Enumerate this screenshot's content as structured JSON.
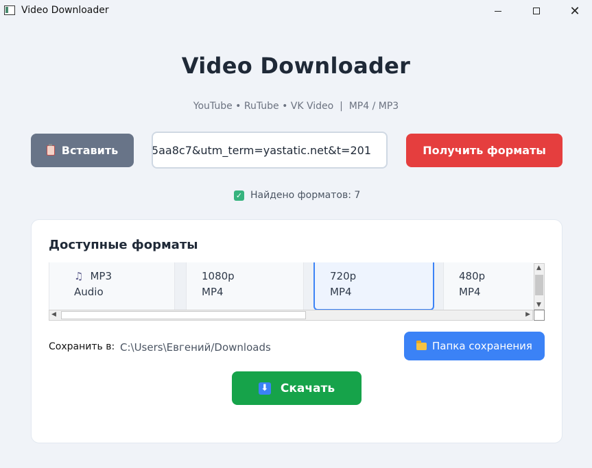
{
  "window": {
    "title": "Video Downloader",
    "min_glyph": "",
    "close_glyph": "✕"
  },
  "header": {
    "title": "Video Downloader",
    "subtitle": "YouTube • RuTube • VK Video  |  MP4 / MP3"
  },
  "toolbar": {
    "paste_label": "Вставить",
    "url_value": "5aa8c7&utm_term=yastatic.net&t=201",
    "fetch_label": "Получить форматы"
  },
  "status": {
    "text": "Найдено форматов: 7"
  },
  "formats": {
    "title": "Доступные форматы",
    "selected_index": 2,
    "items": [
      {
        "quality": "MP3",
        "type": "Audio",
        "icon": "music-icon"
      },
      {
        "quality": "1080p",
        "type": "MP4"
      },
      {
        "quality": "720p",
        "type": "MP4"
      },
      {
        "quality": "480p",
        "type": "MP4"
      }
    ]
  },
  "save": {
    "label": "Сохранить в:",
    "path": "C:\\Users\\Евгений/Downloads",
    "folder_button": "Папка сохранения"
  },
  "download": {
    "label": "Скачать"
  },
  "colors": {
    "paste_button": "#687488",
    "fetch_button": "#e53e3e",
    "folder_button": "#3b82f6",
    "download_button": "#16a34a",
    "selected_border": "#3b82f6"
  }
}
